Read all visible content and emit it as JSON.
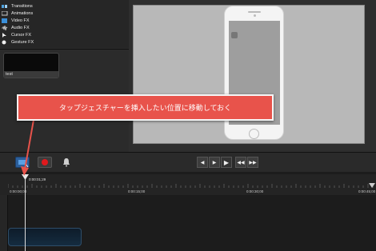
{
  "effects_menu": {
    "items": [
      {
        "label": "Transitions",
        "icon": "transitions-icon"
      },
      {
        "label": "Animations",
        "icon": "animations-icon"
      },
      {
        "label": "Video FX",
        "icon": "video-fx-icon"
      },
      {
        "label": "Audio FX",
        "icon": "audio-fx-icon"
      },
      {
        "label": "Cursor FX",
        "icon": "cursor-fx-icon"
      },
      {
        "label": "Gesture FX",
        "icon": "gesture-fx-icon"
      }
    ]
  },
  "media_bin": {
    "clip_name": "test"
  },
  "callout": {
    "text": "タップジェスチャーを挿入したい位置に移動しておく",
    "color": "#e8534b"
  },
  "toolbar": {
    "record_color": "#e0191d",
    "playback_buttons": [
      "◀",
      "▶",
      "▶",
      "◀◀",
      "▶▶"
    ]
  },
  "timeline": {
    "playhead_time": "0:00:01;29",
    "ticks": [
      "0:00:00;00",
      "0:00:15;00",
      "0:00:30;00",
      "0:00:45;00"
    ]
  }
}
